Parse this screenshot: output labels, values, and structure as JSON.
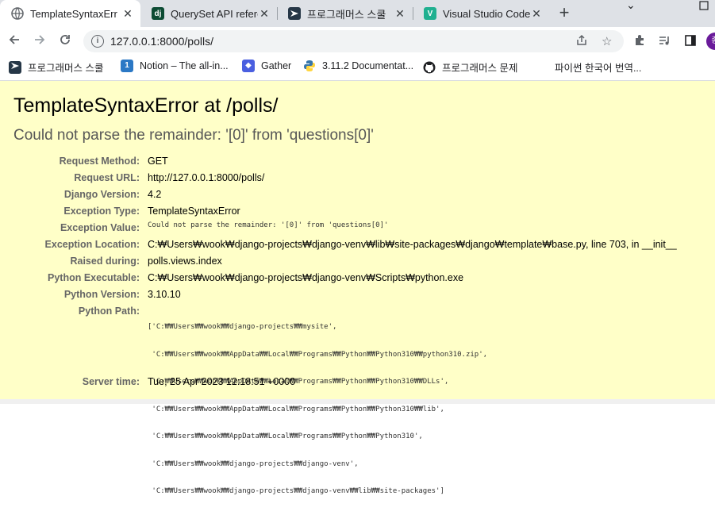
{
  "tabs": [
    {
      "title": "TemplateSyntaxErro",
      "icon": "globe-icon",
      "color": "#5f6368",
      "glyph": "",
      "active": true
    },
    {
      "title": "QuerySet API refere",
      "icon": "django-icon",
      "color": "#0c4b33",
      "glyph": "dj",
      "active": false
    },
    {
      "title": "프로그래머스 스쿨",
      "icon": "programmers-icon",
      "color": "#263747",
      "glyph": "",
      "active": false
    },
    {
      "title": "Visual Studio Code",
      "icon": "vscode-icon",
      "color": "#20b090",
      "glyph": "V",
      "active": false
    }
  ],
  "address": {
    "url": "127.0.0.1:8000/polls/"
  },
  "bookmarks": [
    {
      "label": "프로그래머스 스쿨",
      "icon": "programmers-icon",
      "color": "#263747"
    },
    {
      "label": "Notion – The all-in...",
      "icon": "notion-icon",
      "color": "#2b78c5"
    },
    {
      "label": "Gather",
      "icon": "gather-icon",
      "color": "#4a5fe0"
    },
    {
      "label": "3.11.2 Documentat...",
      "icon": "python-icon",
      "color": "#3776ab"
    },
    {
      "label": "프로그래머스 문제",
      "icon": "github-icon",
      "color": "#202124"
    },
    {
      "label": "파이썬 한국어 번역...",
      "icon": "",
      "color": ""
    }
  ],
  "error": {
    "title": "TemplateSyntaxError at /polls/",
    "subtitle": "Could not parse the remainder: '[0]' from 'questions[0]'"
  },
  "meta": [
    {
      "key": "Request Method:",
      "value": "GET",
      "mono": false
    },
    {
      "key": "Request URL:",
      "value": "http://127.0.0.1:8000/polls/",
      "mono": false
    },
    {
      "key": "Django Version:",
      "value": "4.2",
      "mono": false
    },
    {
      "key": "Exception Type:",
      "value": "TemplateSyntaxError",
      "mono": false
    },
    {
      "key": "Exception Value:",
      "value": "Could not parse the remainder: '[0]' from 'questions[0]'",
      "mono": true
    },
    {
      "key": "Exception Location:",
      "value": "C:₩Users₩wook₩django-projects₩django-venv₩lib₩site-packages₩django₩template₩base.py, line 703, in __init__",
      "mono": false
    },
    {
      "key": "Raised during:",
      "value": "polls.views.index",
      "mono": false
    },
    {
      "key": "Python Executable:",
      "value": "C:₩Users₩wook₩django-projects₩django-venv₩Scripts₩python.exe",
      "mono": false
    },
    {
      "key": "Python Version:",
      "value": "3.10.10",
      "mono": false
    },
    {
      "key": "Python Path:",
      "value": "",
      "mono": true
    },
    {
      "key": "Server time:",
      "value": "Tue, 25 Apr 2023 12:18:51 +0000",
      "mono": false
    }
  ],
  "python_path": [
    "['C:₩₩Users₩₩wook₩₩django-projects₩₩mysite',",
    " 'C:₩₩Users₩₩wook₩₩AppData₩₩Local₩₩Programs₩₩Python₩₩Python310₩₩python310.zip',",
    " 'C:₩₩Users₩₩wook₩₩AppData₩₩Local₩₩Programs₩₩Python₩₩Python310₩₩DLLs',",
    " 'C:₩₩Users₩₩wook₩₩AppData₩₩Local₩₩Programs₩₩Python₩₩Python310₩₩lib',",
    " 'C:₩₩Users₩₩wook₩₩AppData₩₩Local₩₩Programs₩₩Python₩₩Python310',",
    " 'C:₩₩Users₩₩wook₩₩django-projects₩₩django-venv',",
    " 'C:₩₩Users₩₩wook₩₩django-projects₩₩django-venv₩₩lib₩₩site-packages']"
  ],
  "colors": {
    "page_bg": "#ffffc8",
    "key_text": "#666666",
    "subtitle": "#575757"
  }
}
